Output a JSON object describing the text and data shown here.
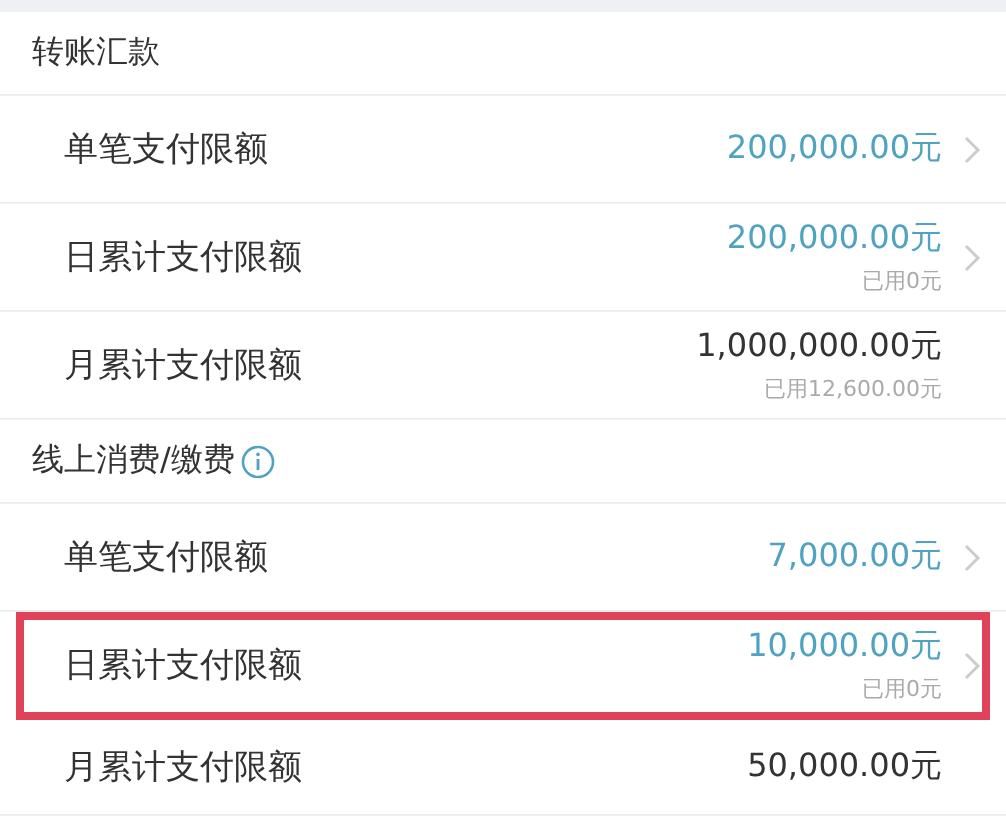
{
  "sections": [
    {
      "title": "转账汇款",
      "info": false,
      "rows": [
        {
          "label": "单笔支付限额",
          "value": "200,000.00元",
          "editable": true,
          "highlighted": false
        },
        {
          "label": "日累计支付限额",
          "value": "200,000.00元",
          "used": "已用0元",
          "editable": true,
          "highlighted": false
        },
        {
          "label": "月累计支付限额",
          "value": "1,000,000.00元",
          "used": "已用12,600.00元",
          "editable": false,
          "highlighted": false
        }
      ]
    },
    {
      "title": "线上消费/缴费",
      "info": true,
      "rows": [
        {
          "label": "单笔支付限额",
          "value": "7,000.00元",
          "editable": true,
          "highlighted": false
        },
        {
          "label": "日累计支付限额",
          "value": "10,000.00元",
          "used": "已用0元",
          "editable": true,
          "highlighted": true
        },
        {
          "label": "月累计支付限额",
          "value": "50,000.00元",
          "editable": false,
          "highlighted": false
        }
      ]
    }
  ]
}
